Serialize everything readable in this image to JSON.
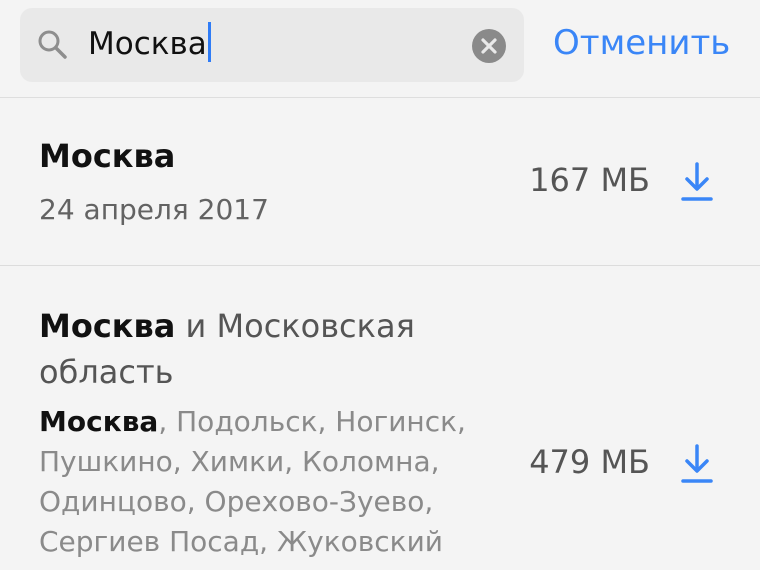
{
  "search": {
    "query": "Москва",
    "cancel_label": "Отменить"
  },
  "results": [
    {
      "title_bold": "Москва",
      "title_rest": "",
      "date": "24 апреля 2017",
      "size": "167 МБ"
    },
    {
      "title_bold": "Москва",
      "title_rest": " и Московская",
      "title_line2": "область",
      "cities_bold": "Москва",
      "cities_rest": ", Подольск, Ногинск, Пушкино, Химки, Коломна, Одинцово, Орехово-Зуево, Сергиев Посад, Жуковский",
      "size": "479 МБ"
    }
  ],
  "colors": {
    "accent": "#3a86f7",
    "caret": "#2f7cf6"
  },
  "icons": [
    "search-icon",
    "clear-icon",
    "download-icon"
  ]
}
